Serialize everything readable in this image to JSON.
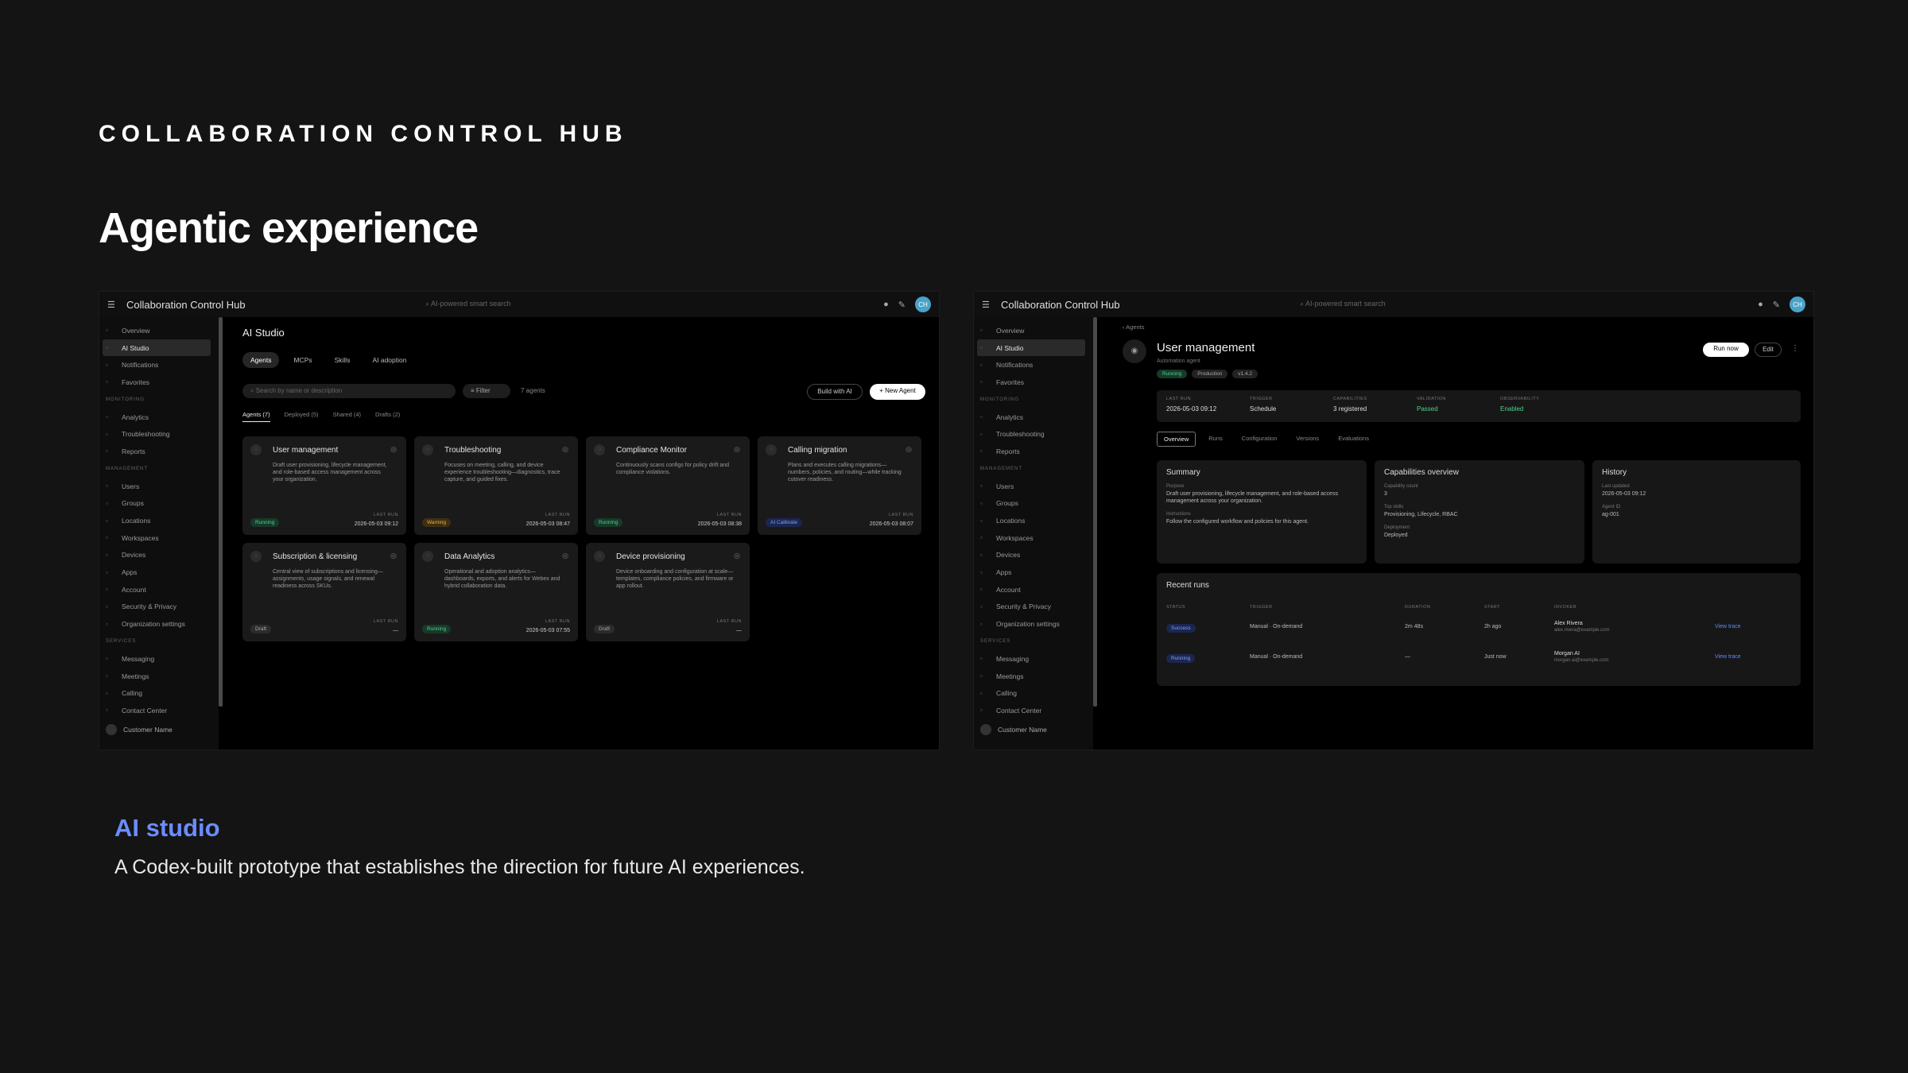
{
  "slide": {
    "eyebrow": "COLLABORATION CONTROL HUB",
    "headline": "Agentic experience",
    "caption_title": "AI studio",
    "caption_text": "A Codex-built prototype that establishes the direction for future AI experiences."
  },
  "app": {
    "title": "Collaboration Control Hub",
    "search_placeholder": "AI-powered smart search",
    "avatar_initials": "CH"
  },
  "sidebar": {
    "items_top": [
      "Overview",
      "AI Studio",
      "Notifications",
      "Favorites"
    ],
    "section_monitoring": "MONITORING",
    "items_monitoring": [
      "Analytics",
      "Troubleshooting",
      "Reports"
    ],
    "section_management": "MANAGEMENT",
    "items_management": [
      "Users",
      "Groups",
      "Locations",
      "Workspaces",
      "Devices",
      "Apps",
      "Account",
      "Security & Privacy",
      "Organization settings"
    ],
    "section_services": "SERVICES",
    "items_services": [
      "Messaging",
      "Meetings",
      "Calling",
      "Contact Center"
    ],
    "profile": "Customer Name"
  },
  "studio": {
    "title": "AI Studio",
    "tabs": [
      "Agents",
      "MCPs",
      "Skills",
      "AI adoption"
    ],
    "search_placeholder": "Search by name or description",
    "filter_label": "Filter",
    "count": "7 agents",
    "build_ai": "Build with AI",
    "new_agent": "+ New Agent",
    "sub_tabs": [
      "Agents (7)",
      "Deployed (5)",
      "Shared (4)",
      "Drafts (2)"
    ],
    "last_run_label": "LAST RUN",
    "cards": [
      {
        "name": "User management",
        "desc": "Draft user provisioning, lifecycle management, and role-based access management across your organization.",
        "badge": "Running",
        "date": "2026-05-03 09:12"
      },
      {
        "name": "Troubleshooting",
        "desc": "Focuses on meeting, calling, and device experience troubleshooting—diagnostics, trace capture, and guided fixes.",
        "badge": "Warning",
        "date": "2026-05-03 08:47"
      },
      {
        "name": "Compliance Monitor",
        "desc": "Continuously scans configs for policy drift and compliance violations.",
        "badge": "Running",
        "date": "2026-05-03 08:38"
      },
      {
        "name": "Calling migration",
        "desc": "Plans and executes calling migrations—numbers, policies, and routing—while tracking cutover readiness.",
        "badge": "AI Calibrate",
        "date": "2026-05-03 08:07"
      },
      {
        "name": "Subscription & licensing",
        "desc": "Central view of subscriptions and licensing—assignments, usage signals, and renewal readiness across SKUs.",
        "badge": "Draft",
        "date": "—"
      },
      {
        "name": "Data Analytics",
        "desc": "Operational and adoption analytics—dashboards, exports, and alerts for Webex and hybrid collaboration data.",
        "badge": "Running",
        "date": "2026-05-03 07:55"
      },
      {
        "name": "Device provisioning",
        "desc": "Device onboarding and configuration at scale—templates, compliance policies, and firmware or app rollout.",
        "badge": "Draft",
        "date": "—"
      }
    ]
  },
  "agent": {
    "breadcrumb": "‹ Agents",
    "title": "User management",
    "subtitle": "Automation agent",
    "tags": [
      "Running",
      "Production",
      "v1.4.2"
    ],
    "run_now": "Run now",
    "edit": "Edit",
    "stats": [
      {
        "label": "LAST RUN",
        "value": "2026-05-03 09:12"
      },
      {
        "label": "TRIGGER",
        "value": "Schedule"
      },
      {
        "label": "CAPABILITIES",
        "value": "3 registered"
      },
      {
        "label": "VALIDATION",
        "value": "Passed"
      },
      {
        "label": "OBSERVABILITY",
        "value": "Enabled"
      }
    ],
    "tabs": [
      "Overview",
      "Runs",
      "Configuration",
      "Versions",
      "Evaluations"
    ],
    "summary": {
      "title": "Summary",
      "purpose_label": "Purpose",
      "purpose": "Draft user provisioning, lifecycle management, and role-based access management across your organization.",
      "instructions_label": "Instructions",
      "instructions": "Follow the configured workflow and policies for this agent."
    },
    "capabilities": {
      "title": "Capabilities overview",
      "count_label": "Capability count",
      "count": "3",
      "top_label": "Top skills",
      "top": "Provisioning, Lifecycle, RBAC",
      "deploy_label": "Deployment",
      "deploy": "Deployed"
    },
    "history": {
      "title": "History",
      "updated_label": "Last updated",
      "updated": "2026-05-03 09:12",
      "id_label": "Agent ID",
      "id": "ag-001"
    },
    "runs": {
      "title": "Recent runs",
      "headers": [
        "STATUS",
        "TRIGGER",
        "DURATION",
        "START",
        "INVOKER"
      ],
      "rows": [
        {
          "status": "Success",
          "trigger": "Manual · On-demand",
          "duration": "2m 48s",
          "start": "2h ago",
          "user": "Alex Rivera",
          "email": "alex.rivera@example.com",
          "link": "View trace"
        },
        {
          "status": "Running",
          "trigger": "Manual · On-demand",
          "duration": "—",
          "start": "Just now",
          "user": "Morgan AI",
          "email": "morgan.ai@example.com",
          "link": "View trace"
        }
      ]
    }
  }
}
